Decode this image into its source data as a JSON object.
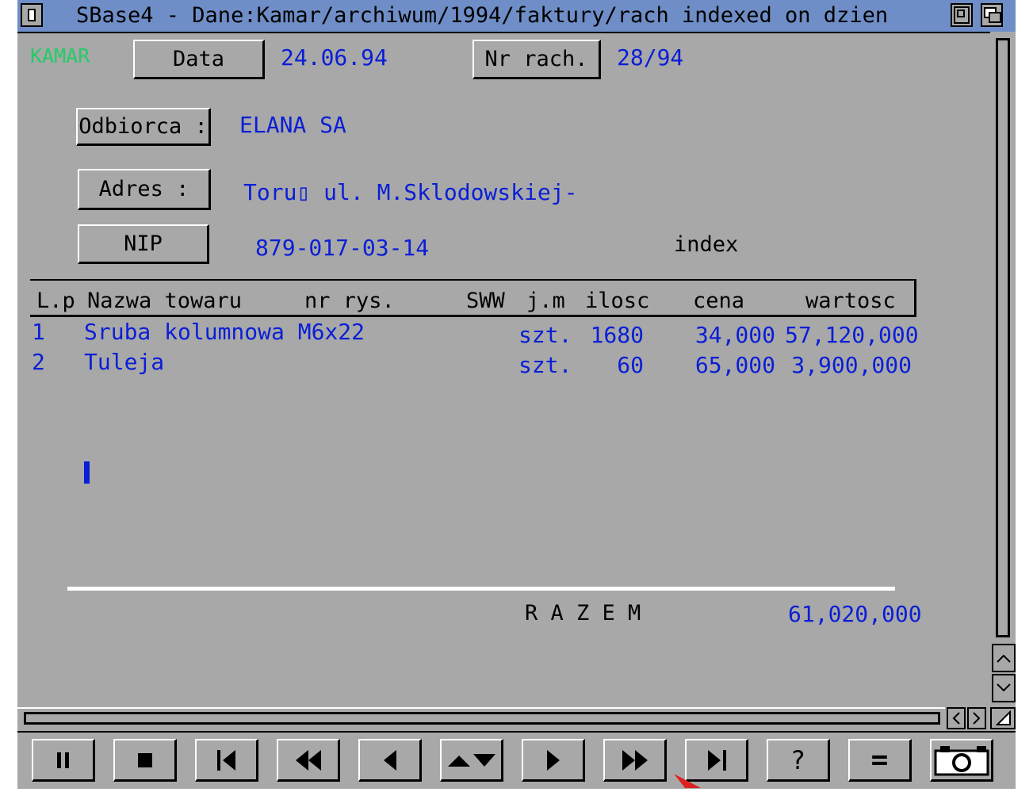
{
  "window": {
    "title": "SBase4 - Dane:Kamar/archiwum/1994/faktury/rach indexed on dzien",
    "close_gadget": "close-gadget-icon",
    "zoom_gadget": "zoom-gadget-icon",
    "depth_gadget": "depth-gadget-icon"
  },
  "form": {
    "company": "KAMAR",
    "date_label": "Data",
    "date_value": "24.06.94",
    "invoice_label": "Nr rach.",
    "invoice_value": "28/94",
    "recipient_label": "Odbiorca :",
    "recipient_value": "ELANA SA",
    "address_label": "Adres :",
    "address_value": "Toru▯ ul. M.Sklodowskiej-",
    "nip_label": "NIP",
    "nip_value": "879-017-03-14",
    "index_label": "index"
  },
  "table": {
    "headers": {
      "lp": "L.p",
      "name": "Nazwa towaru",
      "drawing": "nr rys.",
      "sww": "SWW",
      "unit": "j.m",
      "qty": "ilosc",
      "price": "cena",
      "value": "wartosc"
    },
    "rows": [
      {
        "lp": "1",
        "name": "Sruba kolumnowa M6x22",
        "unit": "szt.",
        "qty": "1680",
        "price": "34,000",
        "value": "57,120,000"
      },
      {
        "lp": "2",
        "name": "Tuleja",
        "unit": "szt.",
        "qty": "60",
        "price": "65,000",
        "value": "3,900,000"
      }
    ]
  },
  "totals": {
    "label": "R A Z E M",
    "value": "61,020,000"
  },
  "controls": [
    {
      "name": "pause-icon",
      "label": "pause"
    },
    {
      "name": "stop-icon",
      "label": "stop"
    },
    {
      "name": "first-record-icon",
      "label": "first"
    },
    {
      "name": "fast-rewind-icon",
      "label": "fast back"
    },
    {
      "name": "previous-record-icon",
      "label": "previous"
    },
    {
      "name": "up-down-icon",
      "label": "up down"
    },
    {
      "name": "next-record-icon",
      "label": "next"
    },
    {
      "name": "fast-forward-icon",
      "label": "fast forward"
    },
    {
      "name": "last-record-icon",
      "label": "last"
    },
    {
      "name": "help-icon",
      "label": "?"
    },
    {
      "name": "equals-icon",
      "label": "="
    },
    {
      "name": "camera-icon",
      "label": "snapshot"
    }
  ],
  "colors": {
    "titlebar": "#6f8ec7",
    "background": "#a8a8a8",
    "value_text": "#0a1ed6",
    "company": "#22cc66"
  }
}
